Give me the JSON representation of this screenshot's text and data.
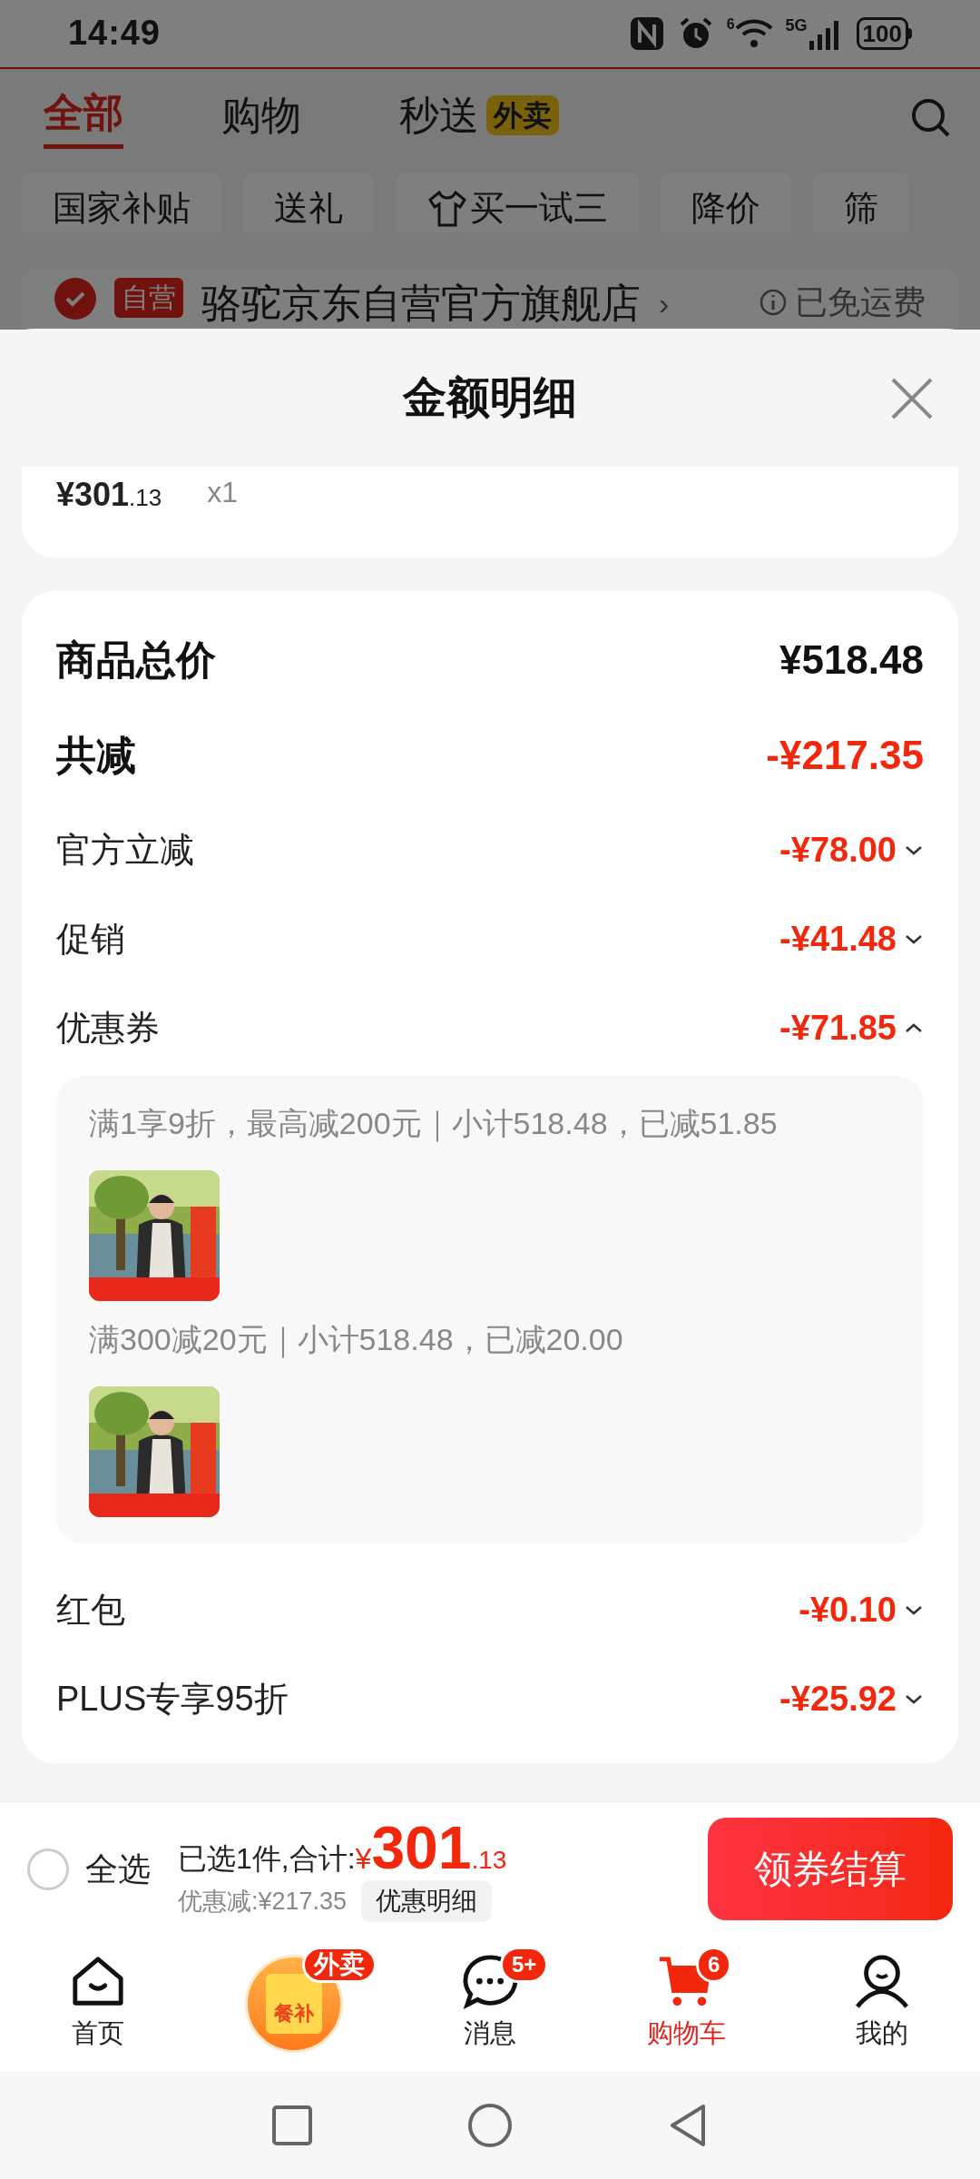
{
  "status_bar": {
    "time": "14:49",
    "wifi_tag": "6",
    "network": "5G",
    "battery": "100"
  },
  "top_tabs": [
    {
      "label": "全部",
      "selected": true
    },
    {
      "label": "购物",
      "selected": false
    },
    {
      "label": "秒送",
      "selected": false,
      "badge": "外卖"
    }
  ],
  "chips": [
    {
      "label": "国家补贴",
      "kind": "plain"
    },
    {
      "label": "送礼",
      "kind": "plain"
    },
    {
      "label": "买一试三",
      "kind": "icon"
    },
    {
      "label": "降价",
      "kind": "plain"
    },
    {
      "label": "筛",
      "kind": "plain"
    }
  ],
  "store": {
    "checked": true,
    "badge": "自营",
    "name": "骆驼京东自营官方旗舰店",
    "chevron": "›",
    "shipping": "已免运费"
  },
  "sheet": {
    "title": "金额明细",
    "item": {
      "price": "¥301",
      "price_decimals": ".13",
      "quantity": "x1"
    },
    "total": {
      "label": "商品总价",
      "value": "¥518.48"
    },
    "reduction": {
      "label": "共减",
      "value": "-¥217.35"
    },
    "rows": [
      {
        "label": "官方立减",
        "value": "-¥78.00",
        "expanded": false
      },
      {
        "label": "促销",
        "value": "-¥41.48",
        "expanded": false
      },
      {
        "label": "优惠券",
        "value": "-¥71.85",
        "expanded": true,
        "details": [
          {
            "text": "满1享9折，最高减200元｜小计518.48，已减51.85",
            "kind": "picture"
          },
          {
            "text": "满300减20元｜小计518.48，已减20.00",
            "kind": "picture"
          }
        ]
      },
      {
        "label": "红包",
        "value": "-¥0.10",
        "expanded": false
      },
      {
        "label": "PLUS专享95折",
        "value": "-¥25.92",
        "expanded": false
      }
    ]
  },
  "checkout_bar": {
    "select_all": {
      "label": "全选",
      "checked": false
    },
    "selected_text": "已选1件,合计:",
    "currency": "¥",
    "amount": "301",
    "amount_decimals": ".13",
    "discount": "优惠减:¥217.35",
    "detail_button": "优惠明细",
    "checkout_button": "领券结算"
  },
  "nav": [
    {
      "label": "首页",
      "kind": "home",
      "selected": false
    },
    {
      "kind": "promo",
      "icon_text": "餐补",
      "badge": "外卖"
    },
    {
      "label": "消息",
      "kind": "chat",
      "badge": "5+",
      "selected": false
    },
    {
      "label": "购物车",
      "kind": "cart",
      "badge": "6",
      "selected": true
    },
    {
      "label": "我的",
      "kind": "profile",
      "selected": false
    }
  ]
}
